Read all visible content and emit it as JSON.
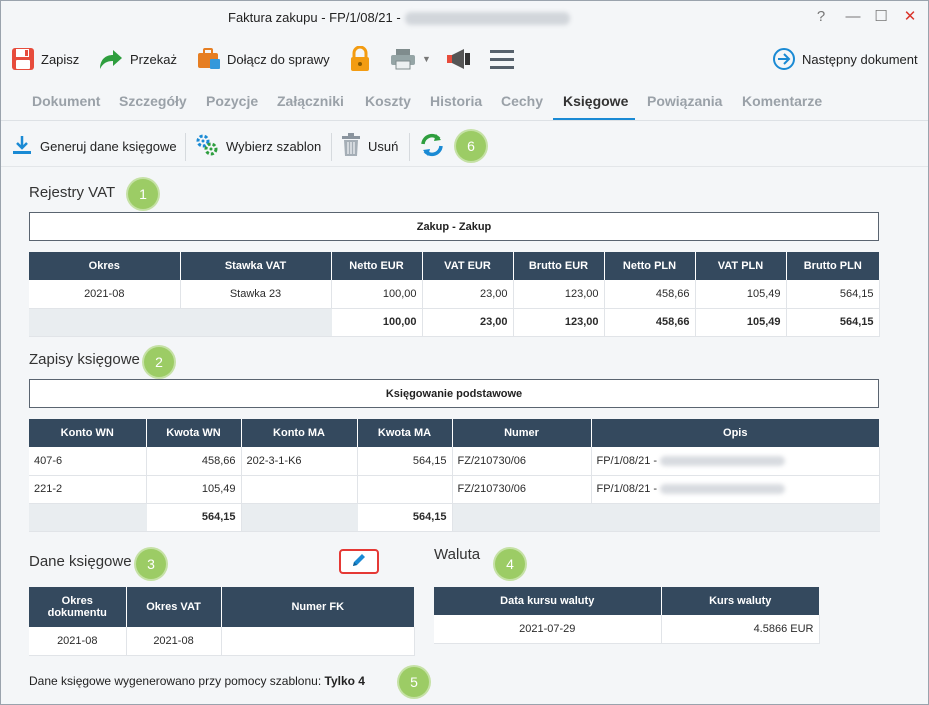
{
  "window": {
    "title": "Faktura zakupu - FP/1/08/21 -",
    "help": "?",
    "minimize": "—",
    "maximize": "☐",
    "close": "✕"
  },
  "toolbar": {
    "save_label": "Zapisz",
    "forward_label": "Przekaż",
    "attach_label": "Dołącz do sprawy",
    "next_label": "Następny dokument"
  },
  "tabs": [
    "Dokument",
    "Szczegóły",
    "Pozycje",
    "Załączniki",
    "Koszty",
    "Historia",
    "Cechy",
    "Księgowe",
    "Powiązania",
    "Komentarze"
  ],
  "active_tab": "Księgowe",
  "subtoolbar": {
    "generate_label": "Generuj dane księgowe",
    "template_label": "Wybierz szablon",
    "delete_label": "Usuń"
  },
  "badges": {
    "b1": "1",
    "b2": "2",
    "b3": "3",
    "b4": "4",
    "b5": "5",
    "b6": "6"
  },
  "vat": {
    "title": "Rejestry VAT",
    "register": "Zakup - Zakup",
    "headers": [
      "Okres",
      "Stawka VAT",
      "Netto EUR",
      "VAT EUR",
      "Brutto EUR",
      "Netto PLN",
      "VAT PLN",
      "Brutto PLN"
    ],
    "row": [
      "2021-08",
      "Stawka 23",
      "100,00",
      "23,00",
      "123,00",
      "458,66",
      "105,49",
      "564,15"
    ],
    "total": [
      "100,00",
      "23,00",
      "123,00",
      "458,66",
      "105,49",
      "564,15"
    ]
  },
  "entries": {
    "title": "Zapisy księgowe",
    "label": "Księgowanie podstawowe",
    "headers": [
      "Konto WN",
      "Kwota WN",
      "Konto MA",
      "Kwota MA",
      "Numer",
      "Opis"
    ],
    "rows": [
      [
        "407-6",
        "458,66",
        "202-3-1-K6",
        "564,15",
        "FZ/210730/06",
        "FP/1/08/21 -"
      ],
      [
        "221-2",
        "105,49",
        "",
        "",
        "FZ/210730/06",
        "FP/1/08/21 -"
      ]
    ],
    "total_wn": "564,15",
    "total_ma": "564,15"
  },
  "accounting": {
    "title": "Dane księgowe",
    "headers": [
      "Okres dokumentu",
      "Okres VAT",
      "Numer FK"
    ],
    "row": [
      "2021-08",
      "2021-08",
      ""
    ]
  },
  "currency": {
    "title": "Waluta",
    "headers": [
      "Data kursu waluty",
      "Kurs waluty"
    ],
    "row": [
      "2021-07-29",
      "4.5866 EUR"
    ]
  },
  "footer": {
    "text": "Dane księgowe wygenerowano przy pomocy szablonu:",
    "template": "Tylko 4"
  },
  "colors": {
    "header_bg": "#34495e",
    "badge": "#9ccc65",
    "accent": "#1a8ad4",
    "edit_border": "#e53935"
  }
}
